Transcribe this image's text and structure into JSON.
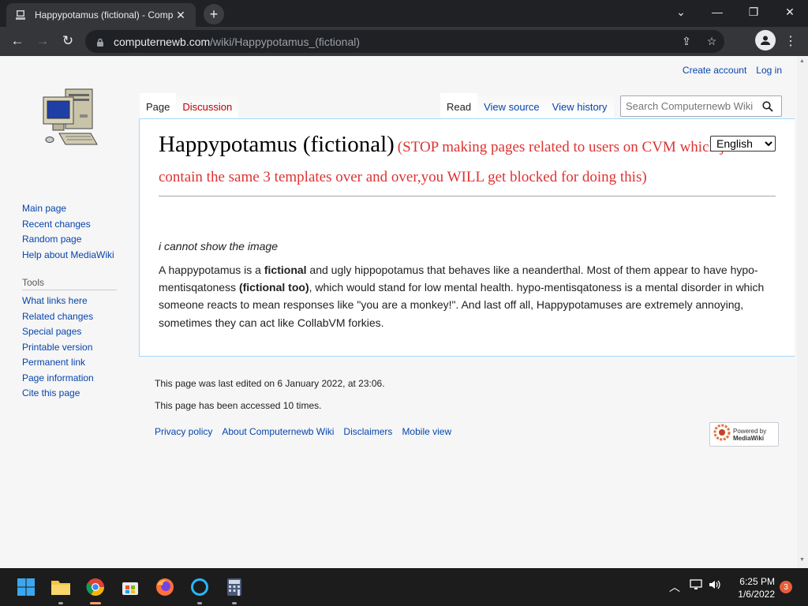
{
  "browser": {
    "tab_title": "Happypotamus (fictional) - Comp",
    "url_domain": "computernewb.com",
    "url_path": "/wiki/Happypotamus_(fictional)",
    "search_placeholder": "Search Computernewb Wiki"
  },
  "personal": {
    "create_account": "Create account",
    "log_in": "Log in"
  },
  "navigation": [
    {
      "label": "Main page"
    },
    {
      "label": "Recent changes"
    },
    {
      "label": "Random page"
    },
    {
      "label": "Help about MediaWiki"
    }
  ],
  "tools": {
    "heading": "Tools",
    "items": [
      {
        "label": "What links here"
      },
      {
        "label": "Related changes"
      },
      {
        "label": "Special pages"
      },
      {
        "label": "Printable version"
      },
      {
        "label": "Permanent link"
      },
      {
        "label": "Page information"
      },
      {
        "label": "Cite this page"
      }
    ]
  },
  "tabs": {
    "page": "Page",
    "discussion": "Discussion",
    "read": "Read",
    "view_source": "View source",
    "view_history": "View history"
  },
  "article": {
    "title": "Happypotamus (fictional)",
    "note": "(STOP making pages related to users on CVM which just contain the same 3 templates over and over,you WILL get blocked for doing this)",
    "language": "English",
    "image_note": "i cannot show the image",
    "p1": "A happypotamus is a ",
    "p1_bold": "fictional",
    "p2": " and ugly hippopotamus that behaves like a neanderthal. Most of them appear to have hypo-mentisqatoness ",
    "p2_bold": "(fictional too)",
    "p3": ", which would stand for low mental health. hypo-mentisqatoness is a mental disorder in which someone reacts to mean responses like \"you are a monkey!\". And last off all, Happypotamuses are extremely annoying, sometimes they can act like CollabVM forkies."
  },
  "footer": {
    "last_edited": "This page was last edited on 6 January 2022, at 23:06.",
    "accessed": "This page has been accessed 10 times.",
    "links": [
      "Privacy policy",
      "About Computernewb Wiki",
      "Disclaimers",
      "Mobile view"
    ],
    "powered_by_line1": "Powered by",
    "powered_by_line2": "MediaWiki"
  },
  "taskbar": {
    "time": "6:25 PM",
    "date": "1/6/2022",
    "notifications": "3"
  }
}
